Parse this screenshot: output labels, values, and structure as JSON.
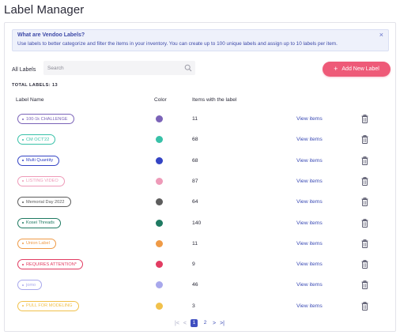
{
  "page": {
    "title": "Label Manager"
  },
  "info": {
    "title": "What are Vendoo Labels?",
    "text": "Use labels to better categorize and filter the items in your inventory. You can create up to 100 unique labels and assign up to 10 labels per item.",
    "close": "×"
  },
  "toolbar": {
    "all_labels": "All Labels",
    "search_placeholder": "Search",
    "add_button": "Add New Label",
    "add_icon": "+"
  },
  "summary": {
    "total_text": "TOTAL LABELS: 13"
  },
  "table": {
    "headers": {
      "name": "Label Name",
      "color": "Color",
      "items": "Items with the label"
    },
    "rows": [
      {
        "label": "100-1k CHALLENGE",
        "color": "#7b63b8",
        "count": "11",
        "action": "View items"
      },
      {
        "label": "CM OCT'22",
        "color": "#38c1a8",
        "count": "68",
        "action": "View items"
      },
      {
        "label": "Multi Quantity",
        "color": "#3444c4",
        "count": "68",
        "action": "View items"
      },
      {
        "label": "LISTING VIDEO",
        "color": "#ee9ab8",
        "count": "87",
        "action": "View items"
      },
      {
        "label": "Memorial Day 2022",
        "color": "#5d5d5d",
        "count": "64",
        "action": "View items"
      },
      {
        "label": "Kosei Threads",
        "color": "#1f7a62",
        "count": "140",
        "action": "View items"
      },
      {
        "label": "Union Label",
        "color": "#ef9a46",
        "count": "11",
        "action": "View items"
      },
      {
        "label": "REQUIRES ATTENTION*",
        "color": "#e23c62",
        "count": "9",
        "action": "View items"
      },
      {
        "label": "jomo",
        "color": "#a8a8ec",
        "count": "46",
        "action": "View items"
      },
      {
        "label": "PULL FOR MODELING",
        "color": "#f1c14b",
        "count": "3",
        "action": "View items"
      }
    ]
  },
  "pagination": {
    "first": "|<",
    "prev": "<",
    "pages": [
      "1",
      "2"
    ],
    "current": "1",
    "next": ">",
    "last": ">|"
  },
  "icons": {
    "search": "search-icon",
    "trash": "trash-icon",
    "close": "close-icon"
  },
  "colors": {
    "accent": "#ee5a78",
    "link": "#3b4bb5",
    "info_bg": "#eef1fb",
    "info_text": "#3e4aa8"
  }
}
